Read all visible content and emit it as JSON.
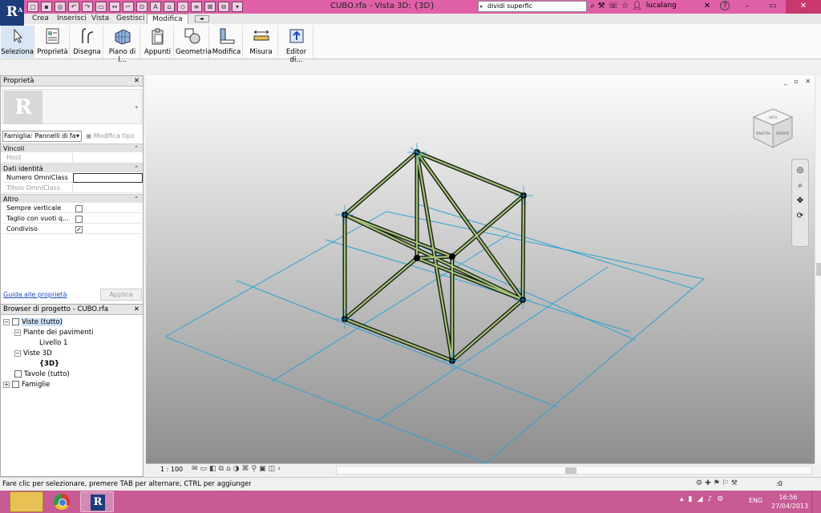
{
  "titlebar": {
    "app_letter": "R",
    "app_sub": "A",
    "doc_title": "CUBO.rfa - Vista 3D: {3D}",
    "search_value": "dividi superfic",
    "user": "lucalang",
    "help": "?"
  },
  "qat_icons": [
    "open-icon",
    "save-icon",
    "sync-icon",
    "undo-icon",
    "redo-icon",
    "print-icon",
    "measure-icon",
    "dimension-icon",
    "tag-icon",
    "text-icon",
    "3d-view-icon",
    "section-icon",
    "thin-lines-icon",
    "close-hidden-icon",
    "switch-windows-icon",
    "dropdown-icon"
  ],
  "tabs": [
    "Crea",
    "Inserisci",
    "Vista",
    "Gestisci",
    "Modifica"
  ],
  "ribbon": [
    {
      "label": "Seleziona",
      "icon": "cursor-icon"
    },
    {
      "label": "Proprietà",
      "icon": "properties-icon"
    },
    {
      "label": "Disegna",
      "icon": "draw-icon"
    },
    {
      "label": "Piano di l...",
      "icon": "work-plane-icon"
    },
    {
      "label": "Appunti",
      "icon": "clipboard-icon"
    },
    {
      "label": "Geometria",
      "icon": "geometry-icon"
    },
    {
      "label": "Modifica",
      "icon": "modify-icon"
    },
    {
      "label": "Misura",
      "icon": "measure-icon"
    },
    {
      "label": "Editor di...",
      "icon": "family-editor-icon"
    }
  ],
  "properties": {
    "title": "Proprietà",
    "family": "Famiglia: Pannelli di fa",
    "edit_type": "Modifica tipo",
    "sections": {
      "vincoli": "Vincoli",
      "host": "Host",
      "dati": "Dati identità",
      "numero": "Numero OmniClass",
      "titolo": "Titolo OmniClass",
      "altro": "Altro",
      "sempre": "Sempre verticale",
      "taglio": "Taglio con vuoti q...",
      "condiviso": "Condiviso"
    },
    "checks": {
      "sempre": false,
      "taglio": false,
      "condiviso": true
    },
    "help_link": "Guida alle proprietà",
    "apply": "Applica"
  },
  "browser": {
    "title": "Browser di progetto - CUBO.rfa",
    "nodes": {
      "viste": "Viste (tutto)",
      "piante": "Piante dei pavimenti",
      "livello": "Livello 1",
      "viste3d": "Viste 3D",
      "v3d": "{3D}",
      "tavole": "Tavole (tutto)",
      "famiglie": "Famiglie"
    }
  },
  "viewport": {
    "viewcube_front": "FRONTE",
    "viewcube_left": "SINISTRA",
    "viewcube_top": "ALTO",
    "scale": "1 : 100"
  },
  "status": {
    "text": "Fare clic per selezionare, premere TAB per alternare, CTRL per aggiungere e MAIUSC",
    "count": ":0"
  },
  "taskbar": {
    "lang": "ENG",
    "time": "16:56",
    "date": "27/04/2013"
  }
}
